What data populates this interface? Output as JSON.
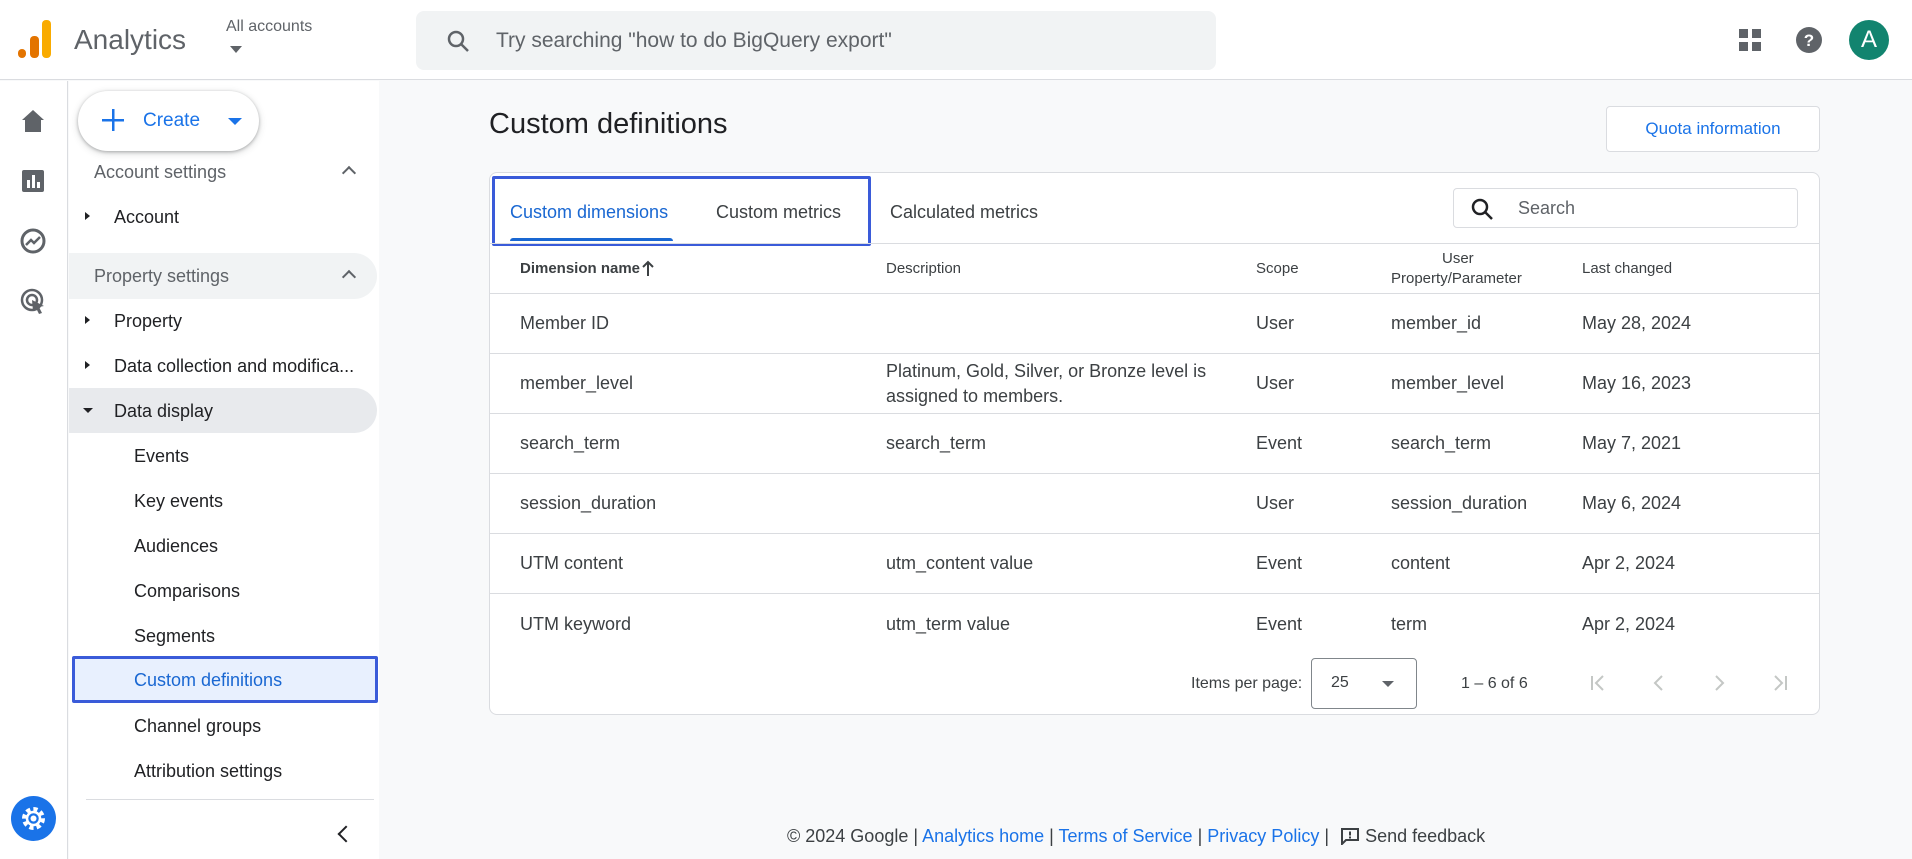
{
  "header": {
    "app_name": "Analytics",
    "account_label": "All accounts",
    "search_placeholder": "Try searching \"how to do BigQuery export\"",
    "avatar_initial": "A"
  },
  "sidebar": {
    "create_label": "Create",
    "account_settings": "Account settings",
    "account": "Account",
    "property_settings": "Property settings",
    "property": "Property",
    "data_collection": "Data collection and modifica...",
    "data_display": "Data display",
    "sub_items": [
      "Events",
      "Key events",
      "Audiences",
      "Comparisons",
      "Segments",
      "Custom definitions",
      "Channel groups",
      "Attribution settings"
    ]
  },
  "main": {
    "title": "Custom definitions",
    "quota_button": "Quota information",
    "tabs": [
      "Custom dimensions",
      "Custom metrics",
      "Calculated metrics"
    ],
    "active_tab": "Custom dimensions",
    "search_placeholder": "Search",
    "columns": {
      "name": "Dimension name",
      "description": "Description",
      "scope": "Scope",
      "user_prop_1": "User",
      "user_prop_2": "Property/Parameter",
      "last_changed": "Last changed"
    },
    "rows": [
      {
        "name": "Member ID",
        "desc1": "",
        "desc2": "",
        "scope": "User",
        "param": "member_id",
        "changed": "May 28, 2024"
      },
      {
        "name": "member_level",
        "desc1": "Platinum, Gold, Silver, or Bronze level is",
        "desc2": "assigned to members.",
        "scope": "User",
        "param": "member_level",
        "changed": "May 16, 2023"
      },
      {
        "name": "search_term",
        "desc1": "search_term",
        "desc2": "",
        "scope": "Event",
        "param": "search_term",
        "changed": "May 7, 2021"
      },
      {
        "name": "session_duration",
        "desc1": "",
        "desc2": "",
        "scope": "User",
        "param": "session_duration",
        "changed": "May 6, 2024"
      },
      {
        "name": "UTM content",
        "desc1": "utm_content value",
        "desc2": "",
        "scope": "Event",
        "param": "content",
        "changed": "Apr 2, 2024"
      },
      {
        "name": "UTM keyword",
        "desc1": "utm_term value",
        "desc2": "",
        "scope": "Event",
        "param": "term",
        "changed": "Apr 2, 2024"
      }
    ],
    "pager": {
      "items_per_page_label": "Items per page:",
      "items_per_page": "25",
      "range": "1 – 6 of 6"
    }
  },
  "footer": {
    "copyright": "© 2024 Google",
    "sep": "|",
    "analytics_home": "Analytics home",
    "terms": "Terms of Service",
    "privacy": "Privacy Policy",
    "feedback": "Send feedback"
  },
  "colors": {
    "accent": "#1a73e8",
    "highlight_border": "#3a5bd9",
    "avatar": "#12846f"
  },
  "icons": [
    "analytics-logo",
    "search-icon",
    "apps-grid-icon",
    "help-icon",
    "home-icon",
    "reports-icon",
    "explore-icon",
    "advertising-icon",
    "admin-gear-icon",
    "plus-icon",
    "sort-arrow-up-icon",
    "first-page-icon",
    "prev-page-icon",
    "next-page-icon",
    "last-page-icon",
    "feedback-icon"
  ]
}
